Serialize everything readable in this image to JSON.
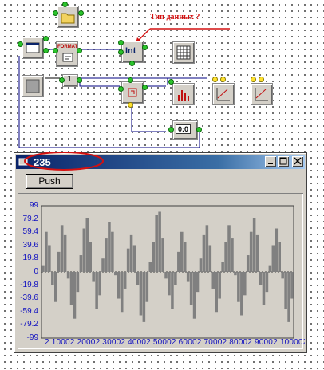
{
  "annotation": {
    "text": "Тип данных ?"
  },
  "window": {
    "title": "235",
    "buttons": {
      "minimize": "_",
      "maximize": "□",
      "close": "×"
    },
    "push_label": "Push"
  },
  "node_labels": {
    "format": "FORMAT",
    "int": "Int",
    "counter": "0:0"
  },
  "colors": {
    "accent": "#d41010",
    "wire": "#000080",
    "signal": "#808080"
  },
  "chart_data": {
    "type": "line",
    "title": "",
    "xlabel": "",
    "ylabel": "",
    "ylim": [
      -99,
      99
    ],
    "y_ticks": [
      "99",
      "79.2",
      "59.4",
      "39.6",
      "19.8",
      "0",
      "-19.8",
      "-39.6",
      "-59.4",
      "-79.2",
      "-99"
    ],
    "x_ticks_text": "2 10002 20002 30002 40002 50002 60002 70002 80002 90002 100002",
    "series": [
      {
        "values": [
          10,
          60,
          40,
          -20,
          -45,
          30,
          70,
          55,
          -10,
          -50,
          -70,
          -30,
          25,
          65,
          80,
          45,
          -15,
          -55,
          -35,
          20,
          50,
          75,
          60,
          -5,
          -40,
          -60,
          -25,
          35,
          55,
          40,
          -20,
          -65,
          -75,
          -45,
          15,
          45,
          85,
          90,
          50,
          -10,
          -35,
          -55,
          -20,
          30,
          60,
          45,
          -15,
          -50,
          -70,
          -30,
          20,
          55,
          70,
          40,
          -25,
          -60,
          -40,
          15,
          45,
          70,
          50,
          -5,
          -45,
          -65,
          -35,
          25,
          60,
          80,
          55,
          -20,
          -50,
          -30,
          10,
          40,
          65,
          45,
          -10,
          -55,
          -75,
          -40
        ]
      }
    ]
  }
}
